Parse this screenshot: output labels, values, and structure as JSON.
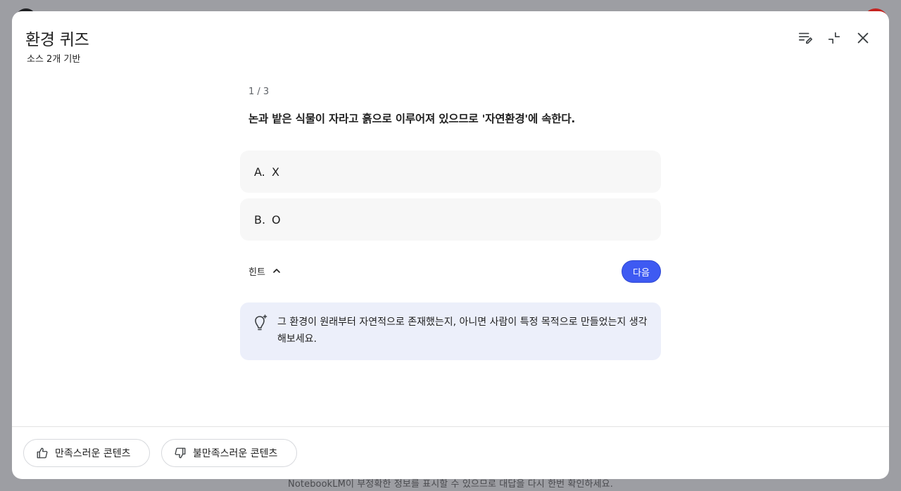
{
  "background": {
    "footer_note": "NotebookLM이 부정확한 정보를 표시할 수 있으므로 대답을 다시 한번 확인하세요."
  },
  "modal": {
    "title": "환경 퀴즈",
    "subtitle": "소스 2개 기반",
    "header_icons": [
      "edit-notes-icon",
      "collapse-icon",
      "close-icon"
    ]
  },
  "quiz": {
    "counter": "1 / 3",
    "question": "논과 밭은 식물이 자라고 흙으로 이루어져 있으므로 '자연환경'에 속한다.",
    "options": [
      {
        "letter": "A.",
        "text": "X"
      },
      {
        "letter": "B.",
        "text": "O"
      }
    ],
    "hint_label": "힌트",
    "next_label": "다음",
    "hint_text": "그 환경이 원래부터 자연적으로 존재했는지, 아니면 사람이 특정 목적으로 만들었는지 생각해보세요."
  },
  "footer": {
    "like_label": "만족스러운 콘텐츠",
    "dislike_label": "불만족스러운 콘텐츠"
  },
  "colors": {
    "accent": "#3e5af2",
    "hint_bg": "#eceffa",
    "option_bg": "#f7f7f7"
  }
}
